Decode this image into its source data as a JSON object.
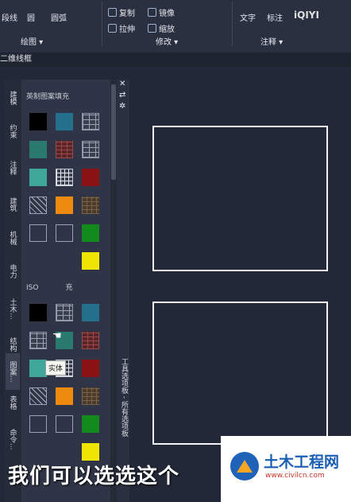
{
  "ribbon": {
    "draw": {
      "items": [
        "段线",
        "圆",
        "圆弧"
      ],
      "label": "绘图 ▾"
    },
    "modify": {
      "items": [
        "复制",
        "镜像",
        "拉伸",
        "缩放"
      ],
      "label": "修改 ▾"
    },
    "annotate": {
      "items": [
        "文字",
        "标注"
      ],
      "label": "注释 ▾"
    }
  },
  "doc_tab": "二维线框",
  "palette": {
    "tabs": [
      "建模",
      "约束",
      "注释",
      "建筑",
      "机械",
      "电力",
      "土木...",
      "结构",
      "图案...",
      "表格",
      "命令..."
    ],
    "active_tab_index": 8,
    "section1_title": "英制图案填充",
    "section2_title": "ISO",
    "section2_suffix": "充",
    "tooltip": "实体",
    "vertical_title": "工具选项板 - 所有选项板",
    "close": "✕",
    "autohide": "⇄",
    "props": "✲",
    "section1_swatches": [
      "#000000",
      "#24708c",
      "brick-gray",
      "#2a7a70",
      "brick-red",
      "brick-gray",
      "#3fa89a",
      "grid",
      "#8a1212",
      "hatch",
      "#ee8a10",
      "brick-brown",
      "dots",
      "dots",
      "#138a1c",
      "empty",
      "empty",
      "#f0e500"
    ],
    "section2_swatches": [
      "#000000",
      "brick-gray",
      "#24708c",
      "brick-gray",
      "#2a7a70",
      "brick-red",
      "#3fa89a",
      "grid",
      "#8a1212",
      "hatch",
      "#ee8a10",
      "brick-brown",
      "dots",
      "dots",
      "#138a1c",
      "empty",
      "empty",
      "#f0e500"
    ]
  },
  "subtitle": "我们可以选选这个",
  "watermark": {
    "title": "土木工程网",
    "url": "www.civilcn.com"
  },
  "iqiyi": "iQIYI"
}
